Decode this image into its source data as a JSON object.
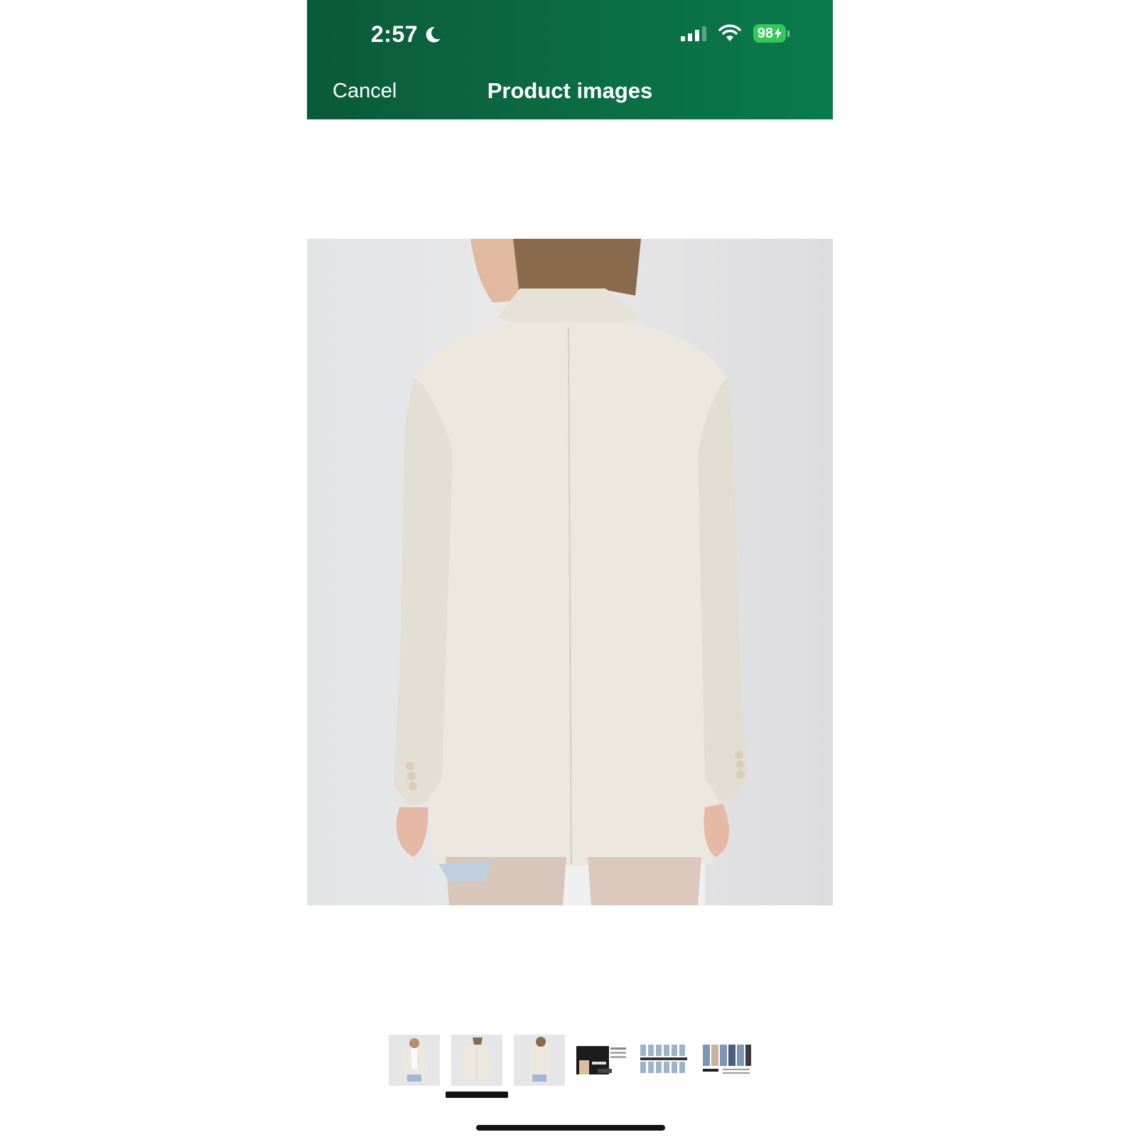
{
  "status_bar": {
    "time": "2:57",
    "battery": "98"
  },
  "nav": {
    "cancel_label": "Cancel",
    "title": "Product images"
  },
  "gallery": {
    "main_image_icon": "product-photo-blazer-back",
    "selected_index": 1,
    "thumbnails": [
      {
        "kind": "model-front"
      },
      {
        "kind": "model-back"
      },
      {
        "kind": "model-side"
      },
      {
        "kind": "collage-dark"
      },
      {
        "kind": "collage-grid"
      },
      {
        "kind": "collage-brand"
      }
    ]
  },
  "colors": {
    "header_green": "#0b6b43",
    "battery_green": "#34c759",
    "blazer": "#ece8df"
  }
}
